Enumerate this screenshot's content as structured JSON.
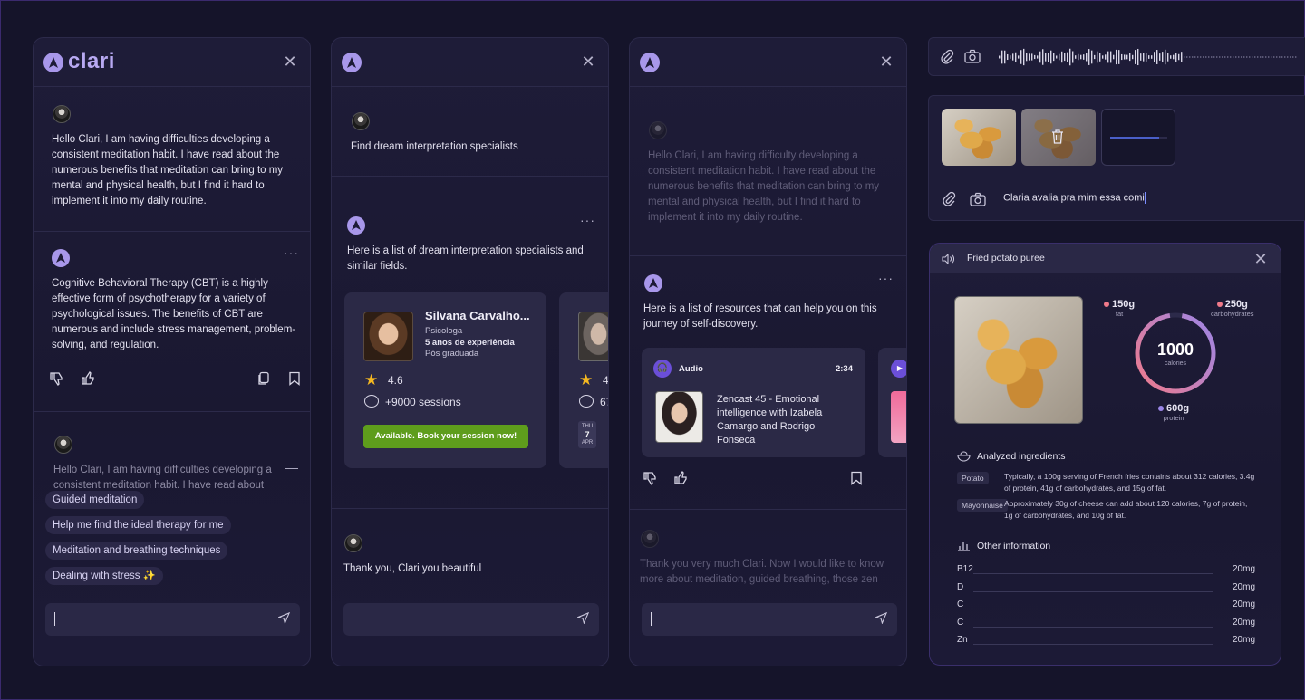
{
  "colors": {
    "accent": "#a897ea",
    "book_green": "#5e9d1c",
    "background": "#15142a",
    "progress_blue": "#4a5fc8"
  },
  "panel1": {
    "logo": "clari",
    "user_message": "Hello Clari, I am having difficulties developing a consistent meditation habit. I have read about the numerous benefits that meditation can bring to my mental and physical health, but I find it hard to implement it into my daily routine.",
    "bot_message": "Cognitive Behavioral Therapy (CBT) is a highly effective form of psychotherapy for a variety of psychological issues. The benefits of CBT are numerous and include stress management, problem-solving, and regulation.",
    "collapsed_message": "Hello Clari, I am having difficulties developing a consistent meditation habit. I have read about the",
    "suggestions": [
      "Guided meditation",
      "Help me find the ideal therapy for me",
      "Meditation and breathing techniques",
      "Dealing with stress ✨"
    ]
  },
  "panel2": {
    "user_message": "Find dream interpretation specialists",
    "bot_message": "Here is a list of dream interpretation specialists and similar fields.",
    "specialist": {
      "name": "Silvana Carvalho...",
      "role": "Psicologa",
      "experience": "5 anos de experiência",
      "degree": "Pós graduada",
      "rating": "4.6",
      "sessions": "+9000 sessions",
      "book_label": "Available. Book your session now!"
    },
    "second_card": {
      "rating": "4",
      "sessions": "67",
      "day_label": "THU",
      "day_num": "7",
      "month": "APR"
    },
    "user_message2": "Thank you, Clari you beautiful"
  },
  "panel3": {
    "user_message": "Hello Clari, I am having difficulty developing a consistent meditation habit. I have read about the numerous benefits that meditation can bring to my mental and physical health, but I find it hard to implement it into my daily routine.",
    "bot_message": "Here is a list of resources that can help you on this journey of self-discovery.",
    "audio": {
      "type": "Audio",
      "duration": "2:34",
      "title": "Zencast 45 - Emotional intelligence with Izabela Camargo and Rodrigo Fonseca"
    },
    "user_message2": "Thank you very much Clari. Now I would like to know more about meditation, guided breathing, those zen"
  },
  "panel4": {
    "input_text": "Claria avalia pra mim essa comi",
    "upload_progress": 0.85
  },
  "nutrition": {
    "title": "Fried potato puree",
    "calories_value": "1000",
    "calories_label": "calories",
    "macros": [
      {
        "value": "150g",
        "label": "fat",
        "color": "#f07a8a"
      },
      {
        "value": "250g",
        "label": "carbohydrates",
        "color": "#f07a8a"
      },
      {
        "value": "600g",
        "label": "protein",
        "color": "#9b86e8"
      }
    ],
    "analyzed_title": "Analyzed ingredients",
    "ingredients": [
      {
        "tag": "Potato",
        "text": "Typically, a 100g serving of French fries contains about 312 calories, 3.4g of protein, 41g of carbohydrates, and 15g of fat."
      },
      {
        "tag": "Mayonnaise",
        "text": "Approximately 30g of cheese can add about 120 calories, 7g of protein, 1g of carbohydrates, and 10g of fat."
      }
    ],
    "other_title": "Other information",
    "other": [
      {
        "name": "B12",
        "value": "20mg"
      },
      {
        "name": "D",
        "value": "20mg"
      },
      {
        "name": "C",
        "value": "20mg"
      },
      {
        "name": "C",
        "value": "20mg"
      },
      {
        "name": "Zn",
        "value": "20mg"
      }
    ]
  }
}
